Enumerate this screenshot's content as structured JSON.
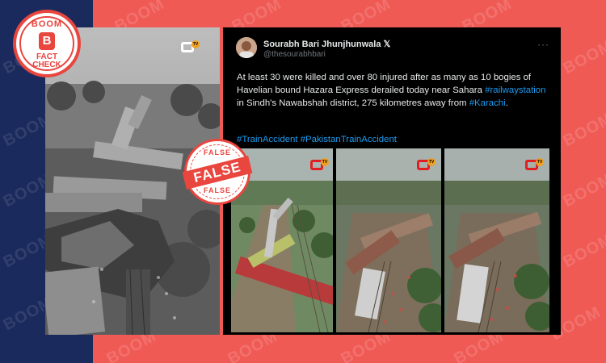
{
  "badge": {
    "top_text": "BOOM",
    "letter": "B",
    "bottom_line1": "FACT",
    "bottom_line2": "CHECK"
  },
  "stamp": {
    "main": "FALSE",
    "ring_top": "FALSE",
    "ring_bottom": "FALSE"
  },
  "watermark": "BOOM",
  "tweet": {
    "author_name": "Sourabh Bari Jhunjhunwala",
    "verified_mark": "𝕏",
    "handle": "@thesourabhbari",
    "more": "···",
    "text_1": "At least 30 were killed and over 80 injured after as many as 10 bogies of Havelian bound Hazara Express derailed today near Sahara",
    "link_1": "#railwaystation",
    "text_2": " in Sindh's Nawabshah district, 275 kilometres away from",
    "link_2": "#Karachi",
    "text_3": ".",
    "hashtags": "#TrainAccident #PakistanTrainAccident"
  },
  "colors": {
    "navy": "#1b2a5c",
    "coral": "#f05a55",
    "boom_red": "#e8463f",
    "tweet_bg": "#000000",
    "link_blue": "#1d9bf0"
  },
  "icons": {
    "channel_logo": "channel-logo-icon",
    "more": "more-options-icon"
  }
}
